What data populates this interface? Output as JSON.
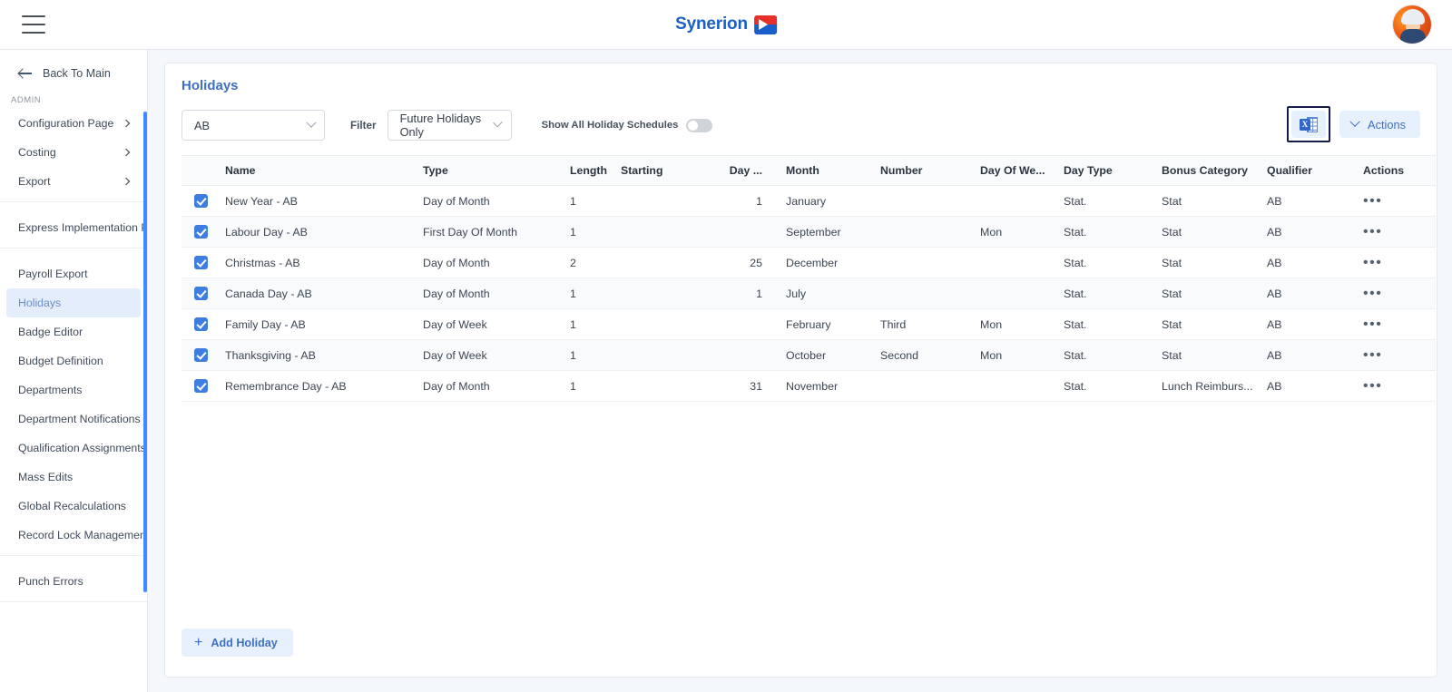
{
  "header": {
    "menu_icon": "hamburger-icon",
    "logo_text": "Synerion",
    "avatar_icon": "user-avatar"
  },
  "sidebar": {
    "back_label": "Back To Main",
    "section_label": "ADMIN",
    "groups": [
      {
        "items": [
          {
            "label": "Configuration Page",
            "has_chevron": true
          },
          {
            "label": "Costing",
            "has_chevron": true
          },
          {
            "label": "Export",
            "has_chevron": true
          }
        ]
      },
      {
        "items": [
          {
            "label": "Express Implementation P...",
            "has_chevron": false
          }
        ]
      },
      {
        "items": [
          {
            "label": "Payroll Export",
            "has_chevron": false
          },
          {
            "label": "Holidays",
            "has_chevron": false,
            "active": true
          },
          {
            "label": "Badge Editor",
            "has_chevron": false
          },
          {
            "label": "Budget Definition",
            "has_chevron": false
          },
          {
            "label": "Departments",
            "has_chevron": false
          },
          {
            "label": "Department Notifications",
            "has_chevron": false
          },
          {
            "label": "Qualification Assignments",
            "has_chevron": false
          },
          {
            "label": "Mass Edits",
            "has_chevron": false
          },
          {
            "label": "Global Recalculations",
            "has_chevron": false
          },
          {
            "label": "Record Lock Management",
            "has_chevron": false
          }
        ]
      },
      {
        "items": [
          {
            "label": "Punch Errors",
            "has_chevron": false
          }
        ]
      }
    ]
  },
  "page": {
    "title": "Holidays"
  },
  "toolbar": {
    "schedule_select_value": "AB",
    "filter_label": "Filter",
    "filter_select_value": "Future Holidays Only",
    "toggle_label": "Show All Holiday Schedules",
    "toggle_on": false,
    "excel_export_icon": "excel-export-icon",
    "actions_label": "Actions"
  },
  "table": {
    "columns": [
      "",
      "Name",
      "Type",
      "Length",
      "Starting",
      "Day ...",
      "Month",
      "Number",
      "Day Of We...",
      "Day Type",
      "Bonus Category",
      "Qualifier",
      "Actions"
    ],
    "rows": [
      {
        "checked": true,
        "name": "New Year - AB",
        "type": "Day of Month",
        "length": "1",
        "starting": "",
        "day": "1",
        "month": "January",
        "number": "",
        "day_of_week": "",
        "day_type": "Stat.",
        "bonus_category": "Stat",
        "qualifier": "AB",
        "actions": "•••"
      },
      {
        "checked": true,
        "name": "Labour Day - AB",
        "type": "First Day Of Month",
        "length": "1",
        "starting": "",
        "day": "",
        "month": "September",
        "number": "",
        "day_of_week": "Mon",
        "day_type": "Stat.",
        "bonus_category": "Stat",
        "qualifier": "AB",
        "actions": "•••"
      },
      {
        "checked": true,
        "name": "Christmas - AB",
        "type": "Day of Month",
        "length": "2",
        "starting": "",
        "day": "25",
        "month": "December",
        "number": "",
        "day_of_week": "",
        "day_type": "Stat.",
        "bonus_category": "Stat",
        "qualifier": "AB",
        "actions": "•••"
      },
      {
        "checked": true,
        "name": "Canada Day - AB",
        "type": "Day of Month",
        "length": "1",
        "starting": "",
        "day": "1",
        "month": "July",
        "number": "",
        "day_of_week": "",
        "day_type": "Stat.",
        "bonus_category": "Stat",
        "qualifier": "AB",
        "actions": "•••"
      },
      {
        "checked": true,
        "name": "Family Day - AB",
        "type": "Day of Week",
        "length": "1",
        "starting": "",
        "day": "",
        "month": "February",
        "number": "Third",
        "day_of_week": "Mon",
        "day_type": "Stat.",
        "bonus_category": "Stat",
        "qualifier": "AB",
        "actions": "•••"
      },
      {
        "checked": true,
        "name": "Thanksgiving - AB",
        "type": "Day of Week",
        "length": "1",
        "starting": "",
        "day": "",
        "month": "October",
        "number": "Second",
        "day_of_week": "Mon",
        "day_type": "Stat.",
        "bonus_category": "Stat",
        "qualifier": "AB",
        "actions": "•••"
      },
      {
        "checked": true,
        "name": "Remembrance Day - AB",
        "type": "Day of Month",
        "length": "1",
        "starting": "",
        "day": "31",
        "month": "November",
        "number": "",
        "day_of_week": "",
        "day_type": "Stat.",
        "bonus_category": "Lunch Reimburs...",
        "qualifier": "AB",
        "actions": "•••"
      }
    ]
  },
  "footer": {
    "add_holiday_label": "Add Holiday",
    "add_icon": "plus-icon"
  },
  "colors": {
    "accent": "#3e6fc4",
    "accent_soft": "#e7f1fd",
    "focus_ring": "#141b4d",
    "checkbox": "#3d7ee0",
    "page_bg": "#f4f7fb"
  }
}
